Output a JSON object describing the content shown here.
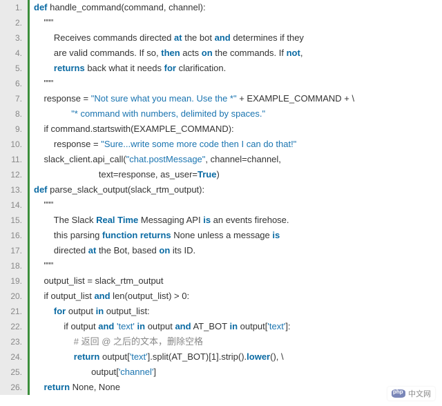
{
  "watermark": "中文网",
  "lines": [
    {
      "n": "1.",
      "tokens": [
        {
          "c": "kw",
          "t": "def"
        },
        {
          "c": "plain",
          "t": " handle_command(command, channel):"
        }
      ]
    },
    {
      "n": "2.",
      "tokens": [
        {
          "c": "plain",
          "t": "    \"\"\""
        }
      ]
    },
    {
      "n": "3.",
      "tokens": [
        {
          "c": "plain",
          "t": "        Receives commands directed "
        },
        {
          "c": "kw",
          "t": "at"
        },
        {
          "c": "plain",
          "t": " the bot "
        },
        {
          "c": "kw",
          "t": "and"
        },
        {
          "c": "plain",
          "t": " determines if they"
        }
      ]
    },
    {
      "n": "4.",
      "tokens": [
        {
          "c": "plain",
          "t": "        are valid commands. If so, "
        },
        {
          "c": "kw",
          "t": "then"
        },
        {
          "c": "plain",
          "t": " acts "
        },
        {
          "c": "kw",
          "t": "on"
        },
        {
          "c": "plain",
          "t": " the commands. If "
        },
        {
          "c": "kw",
          "t": "not"
        },
        {
          "c": "plain",
          "t": ","
        }
      ]
    },
    {
      "n": "5.",
      "tokens": [
        {
          "c": "plain",
          "t": "        "
        },
        {
          "c": "kw",
          "t": "returns"
        },
        {
          "c": "plain",
          "t": " back what it needs "
        },
        {
          "c": "kw",
          "t": "for"
        },
        {
          "c": "plain",
          "t": " clarification."
        }
      ]
    },
    {
      "n": "6.",
      "tokens": [
        {
          "c": "plain",
          "t": "    \"\"\""
        }
      ]
    },
    {
      "n": "7.",
      "tokens": [
        {
          "c": "plain",
          "t": "    response = "
        },
        {
          "c": "str",
          "t": "\"Not sure what you mean. Use the *\""
        },
        {
          "c": "plain",
          "t": " + EXAMPLE_COMMAND + \\"
        }
      ]
    },
    {
      "n": "8.",
      "tokens": [
        {
          "c": "plain",
          "t": "               "
        },
        {
          "c": "str",
          "t": "\"* command with numbers, delimited by spaces.\""
        }
      ]
    },
    {
      "n": "9.",
      "tokens": [
        {
          "c": "plain",
          "t": "    if command.startswith(EXAMPLE_COMMAND):"
        }
      ]
    },
    {
      "n": "10.",
      "tokens": [
        {
          "c": "plain",
          "t": "        response = "
        },
        {
          "c": "str",
          "t": "\"Sure...write some more code then I can do that!\""
        }
      ]
    },
    {
      "n": "11.",
      "tokens": [
        {
          "c": "plain",
          "t": "    slack_client.api_call("
        },
        {
          "c": "str",
          "t": "\"chat.postMessage\""
        },
        {
          "c": "plain",
          "t": ", channel=channel,"
        }
      ]
    },
    {
      "n": "12.",
      "tokens": [
        {
          "c": "plain",
          "t": "                          text=response, as_user="
        },
        {
          "c": "bool",
          "t": "True"
        },
        {
          "c": "plain",
          "t": ")"
        }
      ]
    },
    {
      "n": "13.",
      "tokens": [
        {
          "c": "kw",
          "t": "def"
        },
        {
          "c": "plain",
          "t": " parse_slack_output(slack_rtm_output):"
        }
      ]
    },
    {
      "n": "14.",
      "tokens": [
        {
          "c": "plain",
          "t": "    \"\"\""
        }
      ]
    },
    {
      "n": "15.",
      "tokens": [
        {
          "c": "plain",
          "t": "        The Slack "
        },
        {
          "c": "kw",
          "t": "Real Time"
        },
        {
          "c": "plain",
          "t": " Messaging API "
        },
        {
          "c": "kw",
          "t": "is"
        },
        {
          "c": "plain",
          "t": " an events firehose."
        }
      ]
    },
    {
      "n": "16.",
      "tokens": [
        {
          "c": "plain",
          "t": "        this parsing "
        },
        {
          "c": "kw",
          "t": "function returns"
        },
        {
          "c": "plain",
          "t": " None unless a message "
        },
        {
          "c": "kw",
          "t": "is"
        }
      ]
    },
    {
      "n": "17.",
      "tokens": [
        {
          "c": "plain",
          "t": "        directed "
        },
        {
          "c": "kw",
          "t": "at"
        },
        {
          "c": "plain",
          "t": " the Bot, based "
        },
        {
          "c": "kw",
          "t": "on"
        },
        {
          "c": "plain",
          "t": " its ID."
        }
      ]
    },
    {
      "n": "18.",
      "tokens": [
        {
          "c": "plain",
          "t": "    \"\"\""
        }
      ]
    },
    {
      "n": "19.",
      "tokens": [
        {
          "c": "plain",
          "t": "    output_list = slack_rtm_output"
        }
      ]
    },
    {
      "n": "20.",
      "tokens": [
        {
          "c": "plain",
          "t": "    if output_list "
        },
        {
          "c": "kw",
          "t": "and"
        },
        {
          "c": "plain",
          "t": " len(output_list) > 0:"
        }
      ]
    },
    {
      "n": "21.",
      "tokens": [
        {
          "c": "plain",
          "t": "        "
        },
        {
          "c": "kw",
          "t": "for"
        },
        {
          "c": "plain",
          "t": " output "
        },
        {
          "c": "kw",
          "t": "in"
        },
        {
          "c": "plain",
          "t": " output_list:"
        }
      ]
    },
    {
      "n": "22.",
      "tokens": [
        {
          "c": "plain",
          "t": "            if output "
        },
        {
          "c": "kw",
          "t": "and"
        },
        {
          "c": "plain",
          "t": " "
        },
        {
          "c": "str",
          "t": "'text'"
        },
        {
          "c": "plain",
          "t": " "
        },
        {
          "c": "kw",
          "t": "in"
        },
        {
          "c": "plain",
          "t": " output "
        },
        {
          "c": "kw",
          "t": "and"
        },
        {
          "c": "plain",
          "t": " AT_BOT "
        },
        {
          "c": "kw",
          "t": "in"
        },
        {
          "c": "plain",
          "t": " output["
        },
        {
          "c": "str",
          "t": "'text'"
        },
        {
          "c": "plain",
          "t": "]:"
        }
      ]
    },
    {
      "n": "23.",
      "tokens": [
        {
          "c": "plain",
          "t": "                "
        },
        {
          "c": "cmt",
          "t": "# 返回 @ 之后的文本，删除空格"
        }
      ]
    },
    {
      "n": "24.",
      "tokens": [
        {
          "c": "plain",
          "t": "                "
        },
        {
          "c": "kw",
          "t": "return"
        },
        {
          "c": "plain",
          "t": " output["
        },
        {
          "c": "str",
          "t": "'text'"
        },
        {
          "c": "plain",
          "t": "].split(AT_BOT)[1].strip()."
        },
        {
          "c": "kw",
          "t": "lower"
        },
        {
          "c": "plain",
          "t": "(), \\"
        }
      ]
    },
    {
      "n": "25.",
      "tokens": [
        {
          "c": "plain",
          "t": "                       output["
        },
        {
          "c": "str",
          "t": "'channel'"
        },
        {
          "c": "plain",
          "t": "]"
        }
      ]
    },
    {
      "n": "26.",
      "tokens": [
        {
          "c": "plain",
          "t": "    "
        },
        {
          "c": "kw",
          "t": "return"
        },
        {
          "c": "plain",
          "t": " None, None"
        }
      ]
    }
  ]
}
